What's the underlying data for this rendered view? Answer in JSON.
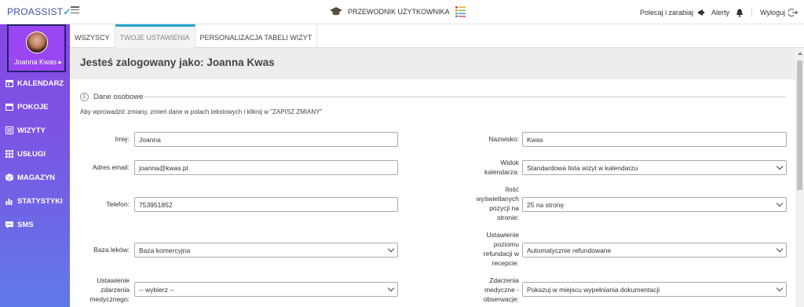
{
  "topbar": {
    "logo": "PROASSIST",
    "guide": "PRZEWODNIK UŻYTKOWNIKA",
    "recommend": "Polecaj i zarabiaj",
    "alerts": "Alerty",
    "logout": "Wyloguj"
  },
  "sidebar": {
    "user": "Joanna Kwas",
    "items": [
      {
        "label": "KALENDARZ",
        "icon": "calendar-icon"
      },
      {
        "label": "POKOJE",
        "icon": "rooms-icon"
      },
      {
        "label": "WIZYTY",
        "icon": "visits-icon"
      },
      {
        "label": "USŁUGI",
        "icon": "grid-icon"
      },
      {
        "label": "MAGAZYN",
        "icon": "box-icon"
      },
      {
        "label": "STATYSTYKI",
        "icon": "bar-chart-icon"
      },
      {
        "label": "SMS",
        "icon": "sms-icon"
      }
    ]
  },
  "tabs": [
    "WSZYSCY",
    "TWOJE USTAWIENIA",
    "PERSONALIZACJA TABELI WIZYT"
  ],
  "main": {
    "title": "Jesteś zalogowany jako: Joanna Kwas",
    "section_number": "1",
    "section_title": "Dane osobowe",
    "instruction": "Aby wprowadzić zmiany, zmień dane w polach tekstowych i kliknij w \"ZAPISZ ZMIANY\""
  },
  "form": {
    "imie_label": "Imię:",
    "imie_value": "Joanna",
    "nazwisko_label": "Nazwisko:",
    "nazwisko_value": "Kwas",
    "email_label": "Adres email:",
    "email_value": "joanna@kwas.pl",
    "widok_label_1": "Widok",
    "widok_label_2": "kalendarza:",
    "widok_value": "Standardowa lista wizyt w kalendarzu",
    "telefon_label": "Telefon:",
    "telefon_value": "753951852",
    "ilosc_label_1": "Ilość",
    "ilosc_label_2": "wyświetlanych",
    "ilosc_label_3": "pozycji na",
    "ilosc_label_4": "stronie:",
    "ilosc_value": "25 na stronę",
    "baza_label": "Baza leków:",
    "baza_value": "Baza komercyjna",
    "refund_label_1": "Ustawienie",
    "refund_label_2": "poziomu",
    "refund_label_3": "refundacji w",
    "refund_label_4": "recepcie:",
    "refund_value": "Automatycznie refundowane",
    "zdarzenie_label_1": "Ustawienie",
    "zdarzenie_label_2": "zdarzenia",
    "zdarzenie_label_3": "medycznego:",
    "zdarzenie_value": "-- wybierz --",
    "obserwacje_label_1": "Zdarzenia",
    "obserwacje_label_2": "medyczne -",
    "obserwacje_label_3": "obserwacje:",
    "obserwacje_value": "Pokazuj w miejscu wypełniania dokumentacji"
  }
}
